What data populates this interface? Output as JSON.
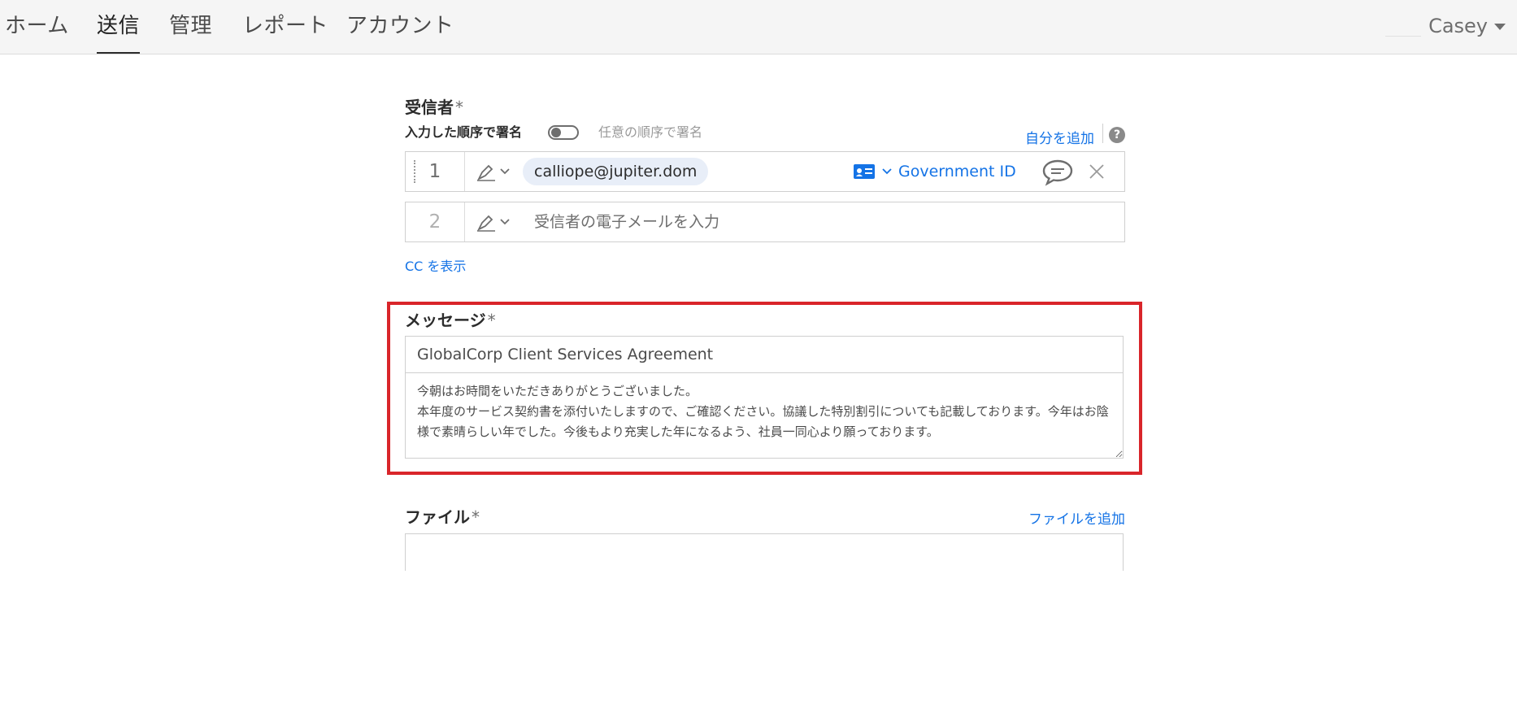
{
  "nav": {
    "tabs": [
      {
        "label": "ホーム",
        "active": false
      },
      {
        "label": "送信",
        "active": true
      },
      {
        "label": "管理",
        "active": false
      },
      {
        "label": "レポート",
        "active": false
      },
      {
        "label": "アカウント",
        "active": false
      }
    ],
    "user_name": "Casey"
  },
  "recipients": {
    "label": "受信者",
    "required_mark": "*",
    "order_label": "入力した順序で署名",
    "any_order_label": "任意の順序で署名",
    "add_me": "自分を追加",
    "help": "?",
    "rows": [
      {
        "number": "1",
        "email": "calliope@jupiter.dom",
        "auth": "Government ID"
      },
      {
        "number": "2",
        "placeholder": "受信者の電子メールを入力"
      }
    ],
    "show_cc": "CC を表示"
  },
  "message": {
    "label": "メッセージ",
    "required_mark": "*",
    "subject": "GlobalCorp Client Services Agreement",
    "body": "今朝はお時間をいただきありがとうございました。\n本年度のサービス契約書を添付いたしますので、ご確認ください。協議した特別割引についても記載しております。今年はお陰様で素晴らしい年でした。今後もより充実した年になるよう、社員一同心より願っております。"
  },
  "file": {
    "label": "ファイル",
    "required_mark": "*",
    "add_file": "ファイルを追加"
  },
  "colors": {
    "link": "#1473e6",
    "highlight": "#d9252a",
    "chip": "#e8eef8"
  }
}
